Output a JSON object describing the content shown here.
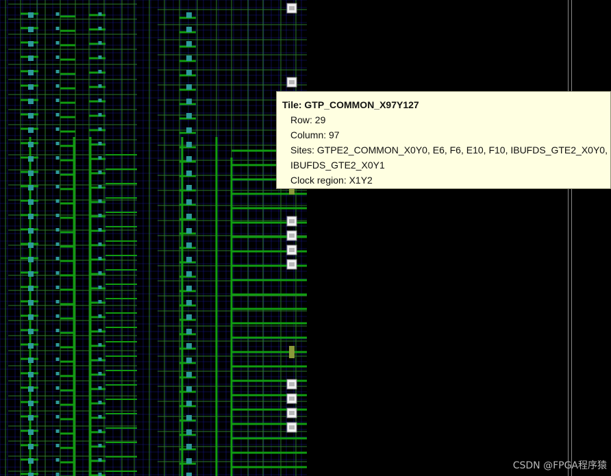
{
  "tooltip": {
    "title": "Tile: GTP_COMMON_X97Y127",
    "row": "Row: 29",
    "column": "Column: 97",
    "sites": "Sites: GTPE2_COMMON_X0Y0, E6, F6, E10, F10, IBUFDS_GTE2_X0Y0,",
    "sites_cont": "IBUFDS_GTE2_X0Y1",
    "clock_region": "Clock region: X1Y2"
  },
  "watermark": "CSDN @FPGA程序猿",
  "colors": {
    "background": "#000000",
    "grid": "#1a1aa0",
    "route": "#119d11",
    "route_thin": "#2c7a2c",
    "site": "#2e9a9a",
    "tooltip_bg": "#ffffe1",
    "annotation": "#5a0f8a"
  },
  "icons": [
    "memory-site-icon"
  ]
}
